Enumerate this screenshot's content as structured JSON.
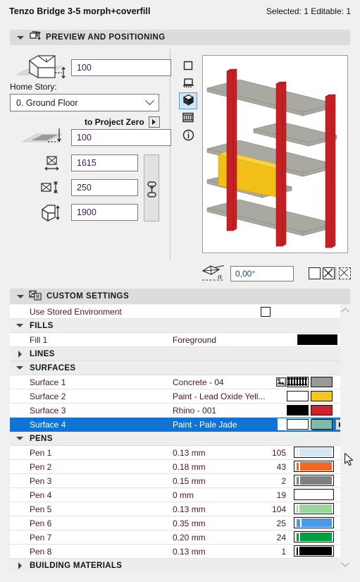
{
  "titlebar": {
    "title": "Tenzo Bridge 3-5 morph+coverfill",
    "status": "Selected: 1 Editable: 1"
  },
  "sections": {
    "preview": {
      "label": "PREVIEW AND POSITIONING",
      "icon": "preview-positioning-icon",
      "expanded": true
    },
    "custom": {
      "label": "CUSTOM SETTINGS",
      "icon": "custom-settings-icon",
      "expanded": true
    }
  },
  "positioning": {
    "elevation_top": {
      "value": "100",
      "icon": "box-on-story-height-icon"
    },
    "home_story_label": "Home Story:",
    "home_story": {
      "value": "0. Ground Floor",
      "icon": "chevron-down-icon"
    },
    "to_project_zero": {
      "label": "to Project Zero",
      "icon": "play-right-icon"
    },
    "project_zero_elevation": {
      "value": "100",
      "icon": "story-elevation-icon"
    },
    "dimension_a": {
      "value": "1615",
      "icon": "width-dimension-icon"
    },
    "dimension_b": {
      "value": "250",
      "icon": "depth-dimension-icon"
    },
    "dimension_c": {
      "value": "1900",
      "icon": "height-dimension-icon"
    },
    "link_proportions": {
      "icon": "chain-link-icon"
    }
  },
  "view_toolbar": [
    {
      "name": "2d-symbol-view-button",
      "icon": "square-icon",
      "selected": false
    },
    {
      "name": "elevation-view-button",
      "icon": "front-elevation-icon",
      "selected": false
    },
    {
      "name": "3d-view-button",
      "icon": "cube-icon",
      "selected": true
    },
    {
      "name": "list-view-button",
      "icon": "film-strip-icon",
      "selected": false
    },
    {
      "name": "info-button",
      "icon": "info-circle-icon",
      "selected": false
    }
  ],
  "preview": {
    "description": "3D axonometric preview of shelving structure: red vertical posts, gray horizontal shelves, yellow panel",
    "colors": {
      "post": "#c62024",
      "shelf": "#a8a8a0",
      "panel": "#f0c018",
      "background": "#ffffff"
    }
  },
  "rotation": {
    "icon": "rotation-angle-icon",
    "value": "0,00°",
    "buttons": [
      {
        "name": "mirror-off-button",
        "icon": "square-empty-icon"
      },
      {
        "name": "mirror-x-button",
        "icon": "square-x-icon"
      },
      {
        "name": "mirror-dashed-button",
        "icon": "square-dashed-x-icon"
      }
    ]
  },
  "custom_settings": {
    "stored_environment": {
      "label": "Use Stored Environment",
      "checked": false
    },
    "groups": [
      {
        "name": "FILLS",
        "expanded": true,
        "rows": [
          {
            "name": "Fill 1",
            "value": "Foreground",
            "swatch_fill": "#000000"
          }
        ]
      },
      {
        "name": "LINES",
        "expanded": false,
        "rows": []
      },
      {
        "name": "SURFACES",
        "expanded": true,
        "rows": [
          {
            "name": "Surface 1",
            "value": "Concrete - 04",
            "has_texture_icon": true,
            "swatch_fill": "hatch",
            "swatch_color": "#9a9a93",
            "selected": false
          },
          {
            "name": "Surface 2",
            "value": "Paint - Lead Oxide Yell...",
            "swatch_fill": "#ffffff",
            "swatch_color": "#f5c518",
            "selected": false
          },
          {
            "name": "Surface 3",
            "value": "Rhino - 001",
            "swatch_fill": "#000000",
            "swatch_color": "#d42028",
            "selected": false
          },
          {
            "name": "Surface 4",
            "value": "Paint - Pale Jade",
            "swatch_fill": "#ffffff",
            "swatch_color": "#7dbaa8",
            "selected": true,
            "has_arrow": true
          }
        ]
      },
      {
        "name": "PENS",
        "expanded": true,
        "rows": [
          {
            "name": "Pen 1",
            "value": "0.13 mm",
            "number": "105",
            "color": "#d6e8f7",
            "thickness": 2
          },
          {
            "name": "Pen 2",
            "value": "0.18 mm",
            "number": "43",
            "color": "#f26522",
            "thickness": 3
          },
          {
            "name": "Pen 3",
            "value": "0.15 mm",
            "number": "2",
            "color": "#808080",
            "thickness": 3
          },
          {
            "name": "Pen 4",
            "value": "0 mm",
            "number": "19",
            "color": "#ffffff",
            "thickness": 0
          },
          {
            "name": "Pen 5",
            "value": "0.13 mm",
            "number": "104",
            "color": "#9bd69b",
            "thickness": 2
          },
          {
            "name": "Pen 6",
            "value": "0.35 mm",
            "number": "25",
            "color": "#4a9ae8",
            "thickness": 5
          },
          {
            "name": "Pen 7",
            "value": "0.20 mm",
            "number": "24",
            "color": "#00a040",
            "thickness": 3
          },
          {
            "name": "Pen 8",
            "value": "0.13 mm",
            "number": "1",
            "color": "#000000",
            "thickness": 2
          }
        ]
      },
      {
        "name": "BUILDING MATERIALS",
        "expanded": false,
        "rows": []
      }
    ]
  },
  "scroll": {
    "up_icon": "chevron-up-icon",
    "down_icon": "chevron-down-icon"
  },
  "cursor": {
    "icon": "mouse-pointer-icon"
  }
}
